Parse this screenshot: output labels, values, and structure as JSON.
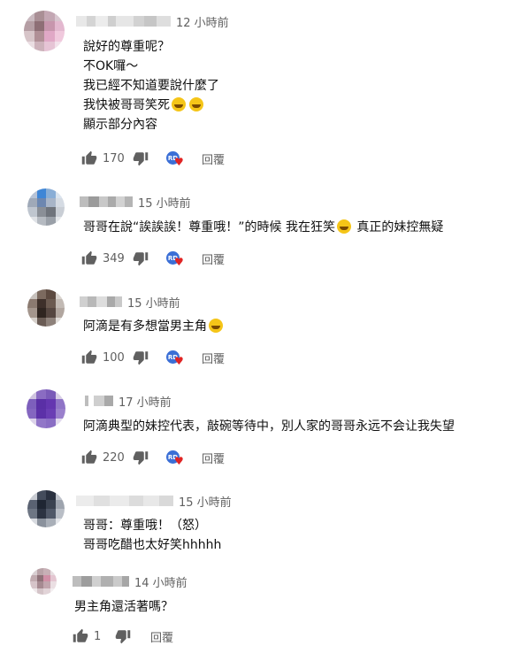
{
  "icons": {
    "like": "thumbs-up-icon",
    "dislike": "thumbs-down-icon",
    "creator_heart": "creator-heart-icon",
    "emoji": "laughing-emoji"
  },
  "colors": {
    "heart": "#e02424",
    "text": "#0f0f0f",
    "meta": "#606060"
  },
  "comments": [
    {
      "time": "12 小時前",
      "lines": [
        "說好的尊重呢？",
        "不OK囉～",
        "我已經不知道要說什麼了",
        "我快被哥哥笑死",
        "顯示部分內容"
      ],
      "likes": "170",
      "reply_label": "回覆"
    },
    {
      "time": "15 小時前",
      "lines": [
        "哥哥在說“誒誒誒！尊重哦！”的時候 我在狂笑",
        " 真正的妹控無疑"
      ],
      "likes": "349",
      "reply_label": "回覆"
    },
    {
      "time": "15 小時前",
      "lines": [
        "阿滴是有多想當男主角"
      ],
      "likes": "100",
      "reply_label": "回覆"
    },
    {
      "time": "17 小時前",
      "lines": [
        "阿滴典型的妹控代表，敲碗等待中，別人家的哥哥永远不会让我失望"
      ],
      "likes": "220",
      "reply_label": "回覆"
    },
    {
      "time": "15 小時前",
      "lines": [
        "哥哥：尊重哦！（怒）",
        "哥哥吃醋也太好笑hhhhh"
      ]
    },
    {
      "time": "14 小時前",
      "lines": [
        "男主角還活著嗎？"
      ],
      "likes": "1",
      "reply_label": "回覆"
    }
  ]
}
